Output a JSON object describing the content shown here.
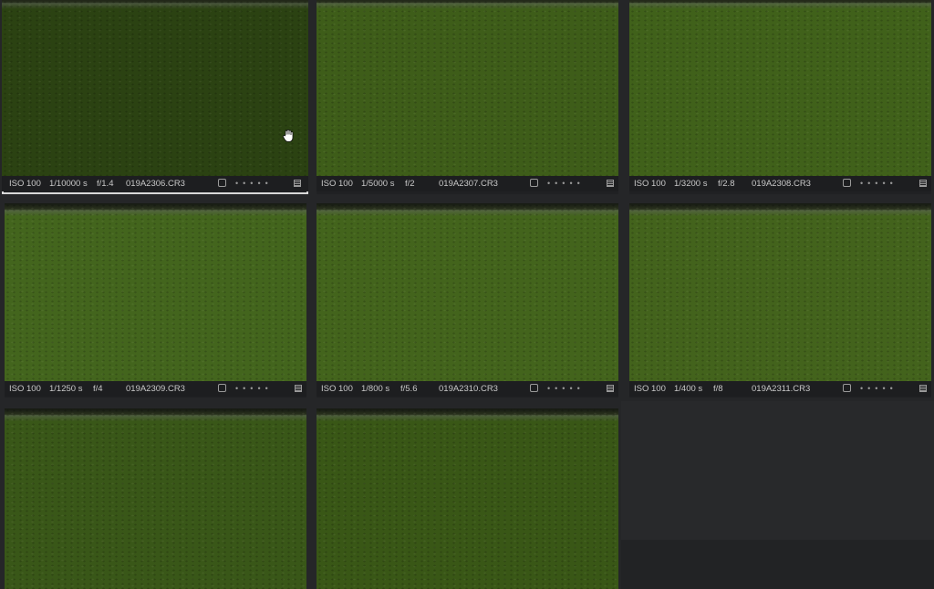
{
  "thumbnails": [
    {
      "iso": "ISO 100",
      "shutter": "1/10000 s",
      "aperture": "f/1.4",
      "filename": "019A2306.CR3",
      "selected": true,
      "tone": "#2c4214"
    },
    {
      "iso": "ISO 100",
      "shutter": "1/5000 s",
      "aperture": "f/2",
      "filename": "019A2307.CR3",
      "selected": false,
      "tone": "#3f5c1c"
    },
    {
      "iso": "ISO 100",
      "shutter": "1/3200 s",
      "aperture": "f/2.8",
      "filename": "019A2308.CR3",
      "selected": false,
      "tone": "#41601d"
    },
    {
      "iso": "ISO 100",
      "shutter": "1/1250 s",
      "aperture": "f/4",
      "filename": "019A2309.CR3",
      "selected": false,
      "tone": "#446420"
    },
    {
      "iso": "ISO 100",
      "shutter": "1/800 s",
      "aperture": "f/5.6",
      "filename": "019A2310.CR3",
      "selected": false,
      "tone": "#44631f"
    },
    {
      "iso": "ISO 100",
      "shutter": "1/400 s",
      "aperture": "f/8",
      "filename": "019A2311.CR3",
      "selected": false,
      "tone": "#44621f"
    },
    {
      "iso": "",
      "shutter": "",
      "aperture": "",
      "filename": "",
      "selected": false,
      "tone": "#3a561a"
    },
    {
      "iso": "",
      "shutter": "",
      "aperture": "",
      "filename": "",
      "selected": false,
      "tone": "#3a5619"
    }
  ],
  "colors": {
    "background": "#252628",
    "meta_bar": "#1d1e20",
    "selection": "#d8d8d8"
  },
  "icons": {
    "checkbox": "checkbox-icon",
    "rating": "rating-dots-icon",
    "menu": "menu-icon",
    "cursor": "hand-cursor-icon"
  }
}
